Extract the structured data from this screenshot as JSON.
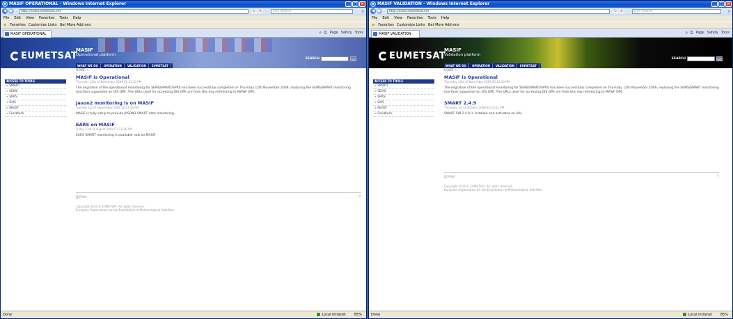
{
  "left": {
    "window_title": "MASIF OPERATIONAL - Windows Internet Explorer",
    "url": "http://masif.eumetsat.int/",
    "tab_title": "MASIF OPERATIONAL",
    "site_title": "MASIF",
    "site_subtitle": "Operational platform",
    "breadcrumb": "HOME >",
    "articles": [
      {
        "title": "MASIF is Operational",
        "date": "Thursday 12th of November 2009 02:31:43 PM",
        "body": "The migration of the operational monitoring for SEMS/SMART/SPRS has been successfully completed on Thursday 12th November 2009, replacing the SEMS/SMART monitoring functions supported on OIS OPE. The URLs used for accessing OIS OPE are from this day redirecting to MASIF OPE."
      },
      {
        "title": "Jason2 monitoring is on MASIF",
        "date": "Tuesday 1st of September 2009 10:07:46 AM",
        "body": "MASIF is fully setup to provide JASON2 SMART data monitoring."
      },
      {
        "title": "EARS on MASIF",
        "date": "Friday 21st of August 2009 07:13:26 AM",
        "body": "EARS SMART monitoring is available now on MASIF"
      }
    ],
    "zoom": "85%"
  },
  "right": {
    "window_title": "MASIF VALIDATION - Windows Internet Explorer",
    "url": "http://masif.eumetsat.int/",
    "tab_title": "MASIF VALIDATION",
    "site_title": "MASIF",
    "site_subtitle": "Validation platform",
    "breadcrumb": "HOME >",
    "articles": [
      {
        "title": "MASIF is Operational",
        "date": "Thursday 12th of November 2009 02:26:43 PM",
        "body": "The migration of the operational monitoring for SEMS/SMART/SPRS has been successfully completed on Thursday 12th November 2009, replacing the SEMS/SMART monitoring functions supported on OIS OPE. The URLs used for accessing OIS OPE are from this day redirecting to MASIF OPE."
      },
      {
        "title": "SMART 2.4.9",
        "date": "Thursday 1st of October 2009 10:13:41 PM",
        "body": "SMART SW 2.4.9 is installed and activated on VAL."
      }
    ],
    "zoom": "85%"
  },
  "common": {
    "logo": "EUMETSAT",
    "search_placeholder": "Live Search",
    "menu": [
      "File",
      "Edit",
      "View",
      "Favorites",
      "Tools",
      "Help"
    ],
    "favorites_label": "Favorites",
    "fav_links": [
      "Customize Links",
      "Get More Add-ons"
    ],
    "cmd_items": [
      "Page",
      "Safety",
      "Tools"
    ],
    "nav_links": [
      "WHAT WE DO",
      "OPERATION",
      "VALIDATION",
      "EUMETSAT"
    ],
    "search_label": "SEARCH",
    "go_label": "GO",
    "nav_head": "ACCESS TO TOOLS",
    "nav_items": [
      "SMART",
      "SEMS",
      "SPRS",
      "DHS",
      "MASIF",
      "Feedback"
    ],
    "print_label": "Print",
    "copyright": "Copyright 2010 © EUMETSAT. All rights reserved.",
    "org": "European Organisation for the Exploitation of Meteorological Satellites",
    "status_done": "Done",
    "zone": "Local intranet"
  }
}
